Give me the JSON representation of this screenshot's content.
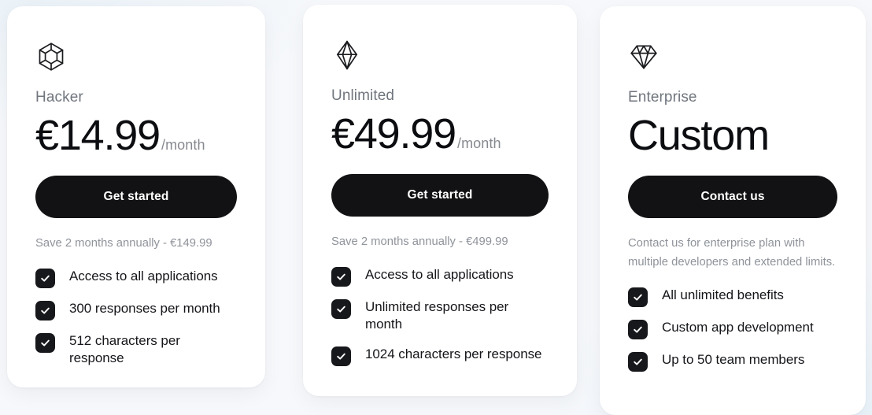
{
  "theme": {
    "page_background": "#f6f8fb",
    "card_background": "#ffffff",
    "button_background": "#121214",
    "button_text_color": "#ffffff",
    "checkbox_background": "#17181b",
    "muted_text_color": "#8f939a",
    "primary_text_color": "#15161a"
  },
  "plans": [
    {
      "icon_name": "hexagon-gem-icon",
      "name": "Hacker",
      "price": "€14.99",
      "period": "/month",
      "cta_label": "Get started",
      "note": "Save 2 months annually - €149.99",
      "features": [
        "Access to all applications",
        "300 responses per month",
        "512 characters per response"
      ]
    },
    {
      "icon_name": "octahedron-gem-icon",
      "name": "Unlimited",
      "price": "€49.99",
      "period": "/month",
      "cta_label": "Get started",
      "note": "Save 2 months annually - €499.99",
      "features": [
        "Access to all applications",
        "Unlimited responses per month",
        "1024 characters per response"
      ]
    },
    {
      "icon_name": "diamond-gem-icon",
      "name": "Enterprise",
      "price": "Custom",
      "period": "",
      "cta_label": "Contact us",
      "note": "Contact us for enterprise plan with multiple developers and extended limits.",
      "features": [
        "All unlimited benefits",
        "Custom app development",
        "Up to 50 team members"
      ]
    }
  ]
}
